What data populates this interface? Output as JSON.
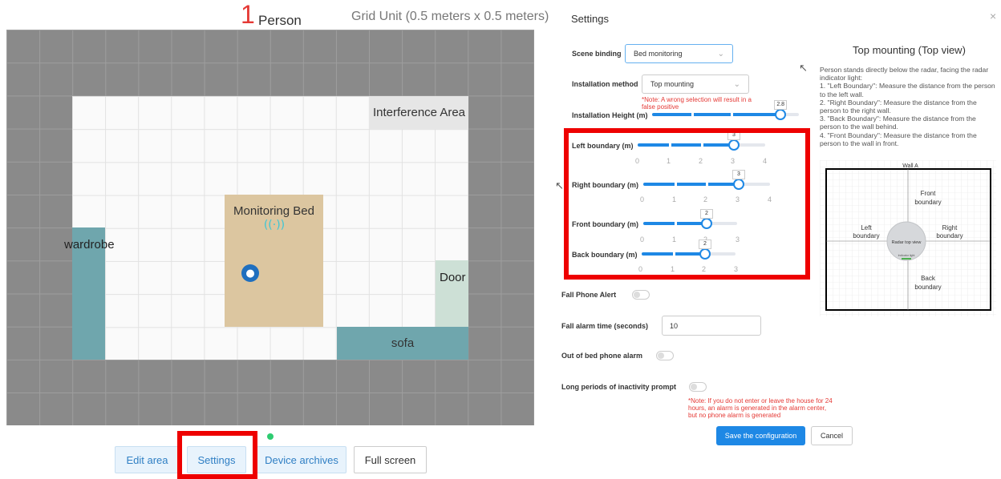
{
  "header": {
    "person_count": "1",
    "person_label": "Person",
    "grid_unit": "Grid Unit (0.5 meters x 0.5 meters)"
  },
  "map": {
    "interference_area": "Interference Area",
    "monitoring_bed": "Monitoring Bed",
    "wardrobe": "wardrobe",
    "door": "Door",
    "sofa": "sofa",
    "radar_icon": "((·))",
    "person_icon": "person-icon",
    "colors": {
      "outside": "#8a8a8a",
      "room": "#fafafa",
      "bed": "#dcc6a0",
      "furniture": "#6fa6ad",
      "door": "#cde0d6",
      "interference": "#e6e6e6",
      "status_dot": "#2ecc71"
    }
  },
  "bottom_buttons": {
    "edit_area": "Edit area",
    "settings": "Settings",
    "device_archives": "Device archives",
    "full_screen": "Full screen"
  },
  "settings": {
    "title": "Settings",
    "close": "×",
    "scene_binding": {
      "label": "Scene binding",
      "value": "Bed monitoring"
    },
    "installation_method": {
      "label": "Installation method",
      "value": "Top mounting",
      "note": "*Note: A wrong selection will result in a false positive"
    },
    "installation_height": {
      "label": "Installation Height (m)",
      "value": "2.8",
      "fraction": 0.87
    },
    "left_boundary": {
      "label": "Left boundary (m)",
      "value": "3",
      "ticks": [
        "0",
        "1",
        "2",
        "3",
        "4"
      ]
    },
    "right_boundary": {
      "label": "Right boundary (m)",
      "value": "3",
      "ticks": [
        "0",
        "1",
        "2",
        "3",
        "4"
      ]
    },
    "front_boundary": {
      "label": "Front boundary (m)",
      "value": "2",
      "ticks": [
        "0",
        "1",
        "2",
        "3"
      ]
    },
    "back_boundary": {
      "label": "Back boundary (m)",
      "value": "2",
      "ticks": [
        "0",
        "1",
        "2",
        "3"
      ]
    },
    "fall_phone_alert": {
      "label": "Fall Phone Alert",
      "on": false
    },
    "fall_alarm_time": {
      "label": "Fall alarm time (seconds)",
      "value": "10"
    },
    "out_of_bed_alarm": {
      "label": "Out of bed phone alarm",
      "on": false
    },
    "inactivity_prompt": {
      "label": "Long periods of inactivity prompt",
      "on": false,
      "note": "*Note: If you do not enter or leave the house for 24 hours, an alarm is generated in the alarm center, but no phone alarm is generated"
    },
    "save": "Save the configuration",
    "cancel": "Cancel"
  },
  "help": {
    "title": "Top mounting (Top view)",
    "lines": [
      "Person stands directly below the radar, facing the radar indicator light:",
      "1. \"Left Boundary\": Measure the distance from the person to the left wall.",
      "2. \"Right Boundary\": Measure the distance from the person to the right wall.",
      "3. \"Back Boundary\": Measure the distance from the person to the wall behind.",
      "4. \"Front Boundary\": Measure the distance from the person to the wall in front."
    ],
    "diagram": {
      "wall": "Wall A",
      "front": [
        "Front",
        "boundary"
      ],
      "left": [
        "Left",
        "boundary"
      ],
      "right": [
        "Right",
        "boundary"
      ],
      "back": [
        "Back",
        "boundary"
      ],
      "radar": "Radar top view",
      "indicator": "Indicator light"
    }
  }
}
